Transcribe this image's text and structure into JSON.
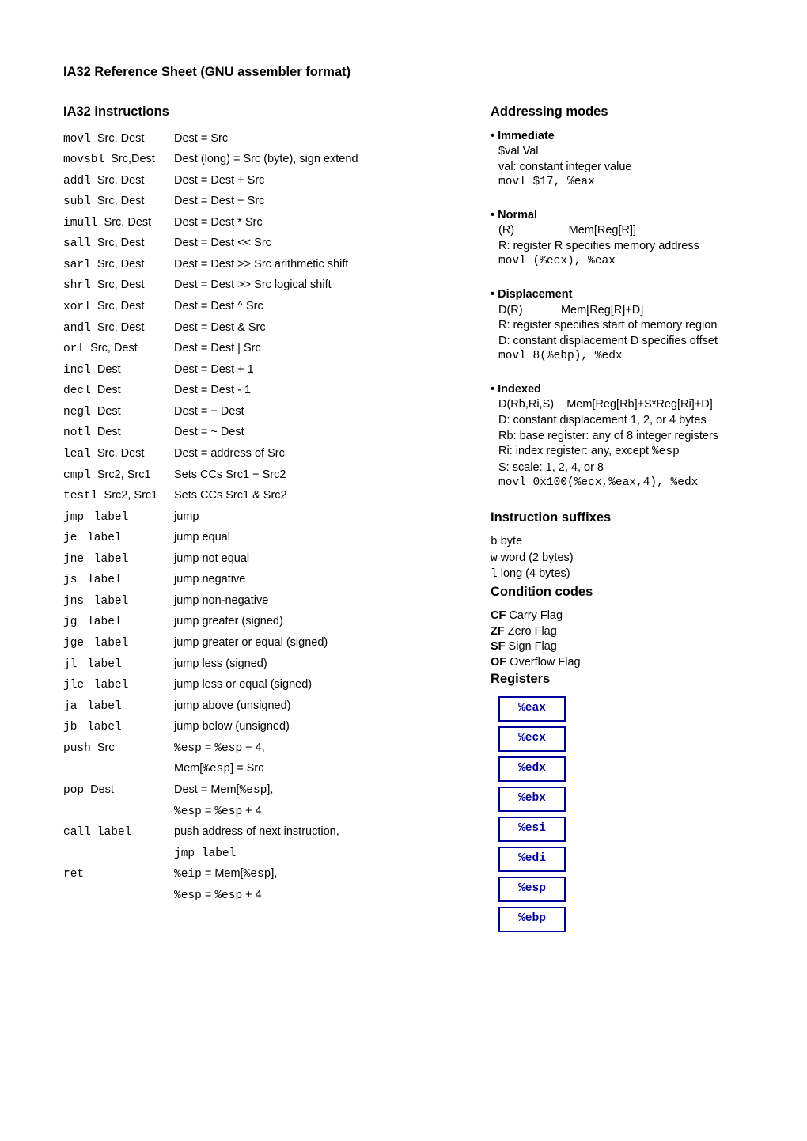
{
  "title": "IA32 Reference Sheet (GNU assembler format)",
  "instructions_heading": "IA32 instructions",
  "instructions": [
    {
      "op": "movl",
      "args": "Src, Dest",
      "desc": "Dest = Src"
    },
    {
      "op": "movsbl",
      "args": "Src,Dest",
      "desc": "Dest (long) = Src (byte), sign extend"
    },
    {
      "op": "addl",
      "args": "Src, Dest",
      "desc": "Dest = Dest + Src"
    },
    {
      "op": "subl",
      "args": "Src, Dest",
      "desc": "Dest = Dest − Src"
    },
    {
      "op": "imull",
      "args": "Src, Dest",
      "desc": "Dest = Dest * Src"
    },
    {
      "op": "sall",
      "args": "Src, Dest",
      "desc": "Dest = Dest << Src"
    },
    {
      "op": "sarl",
      "args": "Src, Dest",
      "desc": "Dest = Dest >> Src    arithmetic shift"
    },
    {
      "op": "shrl",
      "args": "Src, Dest",
      "desc": "Dest = Dest >> Src    logical shift"
    },
    {
      "op": "xorl",
      "args": "Src, Dest",
      "desc": "Dest = Dest ^ Src"
    },
    {
      "op": "andl",
      "args": "Src, Dest",
      "desc": "Dest = Dest & Src"
    },
    {
      "op": "orl",
      "args": "Src, Dest",
      "desc": "Dest = Dest | Src"
    },
    {
      "op": "incl",
      "args": "Dest",
      "desc": "Dest = Dest + 1"
    },
    {
      "op": "decl",
      "args": "Dest",
      "desc": "Dest = Dest - 1"
    },
    {
      "op": "negl",
      "args": "Dest",
      "desc": "Dest = − Dest"
    },
    {
      "op": "notl",
      "args": "Dest",
      "desc": "Dest = ~ Dest"
    },
    {
      "op": "leal",
      "args": "Src, Dest",
      "desc": "Dest = address of Src"
    },
    {
      "op": "cmpl",
      "args": "Src2, Src1",
      "desc": "Sets CCs Src1 − Src2"
    },
    {
      "op": "testl",
      "args": "Src2, Src1",
      "desc": "Sets CCs Src1 & Src2"
    },
    {
      "op": "jmp",
      "args_tt": "label",
      "desc": "jump"
    },
    {
      "op": "je",
      "args_tt": "label",
      "desc": "jump equal"
    },
    {
      "op": "jne",
      "args_tt": "label",
      "desc": "jump not equal"
    },
    {
      "op": "js",
      "args_tt": "label",
      "desc": "jump negative"
    },
    {
      "op": "jns",
      "args_tt": "label",
      "desc": "jump non-negative"
    },
    {
      "op": "jg",
      "args_tt": "label",
      "desc": "jump greater (signed)"
    },
    {
      "op": "jge",
      "args_tt": "label",
      "desc": "jump greater or equal (signed)"
    },
    {
      "op": "jl",
      "args_tt": "label",
      "desc": "jump less (signed)"
    },
    {
      "op": "jle",
      "args_tt": "label",
      "desc": "jump less or equal (signed)"
    },
    {
      "op": "ja",
      "args_tt": "label",
      "desc": "jump above (unsigned)"
    },
    {
      "op": "jb",
      "args_tt": "label",
      "desc": "jump below (unsigned)"
    }
  ],
  "push": {
    "op": "push",
    "args": "Src"
  },
  "pop": {
    "op": "pop",
    "args": "Dest"
  },
  "call": {
    "op": "call",
    "args_tt": "label"
  },
  "ret": {
    "op": "ret"
  },
  "push_l1a": "%esp",
  "push_l1b": " = ",
  "push_l1c": "%esp",
  "push_l1d": " − 4,",
  "push_l2a": "Mem[",
  "push_l2b": "%esp",
  "push_l2c": "] = Src",
  "pop_l1a": "Dest = Mem[",
  "pop_l1b": "%esp",
  "pop_l1c": "],",
  "pop_l2a": "%esp",
  "pop_l2b": " = ",
  "pop_l2c": "%esp",
  "pop_l2d": " + 4",
  "call_l1": "push address of next instruction,",
  "call_l2": "jmp label",
  "ret_l1a": "%eip",
  "ret_l1b": " = Mem[",
  "ret_l1c": "%esp",
  "ret_l1d": "],",
  "ret_l2a": "%esp",
  "ret_l2b": " = ",
  "ret_l2c": "%esp",
  "ret_l2d": " + 4",
  "addressing_heading": "Addressing modes",
  "addr": {
    "immediate": {
      "title": "Immediate",
      "l1": "$val Val",
      "l2": "val:   constant integer value",
      "code": "movl $17, %eax"
    },
    "normal": {
      "title": "Normal",
      "l1": "(R)                 Mem[Reg[R]]",
      "l2": "R:     register R specifies memory address",
      "code": "movl (%ecx), %eax"
    },
    "displacement": {
      "title": "Displacement",
      "l1": "D(R)            Mem[Reg[R]+D]",
      "l2": "R:     register specifies start of memory region",
      "l3": "D:     constant displacement D specifies offset",
      "code": "movl 8(%ebp), %edx"
    },
    "indexed": {
      "title": "Indexed",
      "l1": "D(Rb,Ri,S)    Mem[Reg[Rb]+S*Reg[Ri]+D]",
      "l2": "D:    constant displacement 1, 2, or 4 bytes",
      "l3": "Rb:  base register: any of 8 integer registers",
      "l4a": "Ri:    index register: any, except ",
      "l4b": "%esp",
      "l5": "S:     scale: 1, 2, 4, or 8",
      "code": "movl 0x100(%ecx,%eax,4), %edx"
    }
  },
  "suffixes_heading": "Instruction suffixes",
  "suffixes": [
    {
      "code": "b",
      "desc": "byte"
    },
    {
      "code": "w",
      "desc": "word (2 bytes)"
    },
    {
      "code": "l",
      "desc": "long (4 bytes)"
    }
  ],
  "cc_heading": "Condition codes",
  "cc": [
    {
      "code": "CF",
      "desc": "Carry Flag"
    },
    {
      "code": "ZF",
      "desc": "Zero Flag"
    },
    {
      "code": "SF",
      "desc": "Sign Flag"
    },
    {
      "code": "OF",
      "desc": "Overflow Flag"
    }
  ],
  "registers_heading": "Registers",
  "registers": [
    "%eax",
    "%ecx",
    "%edx",
    "%ebx",
    "%esi",
    "%edi",
    "%esp",
    "%ebp"
  ]
}
